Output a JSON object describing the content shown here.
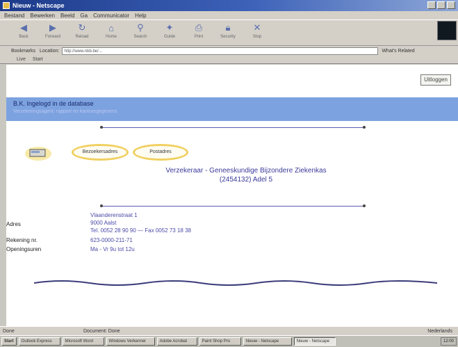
{
  "window": {
    "title": "Nieuw - Netscape"
  },
  "menu": [
    "Bestand",
    "Bewerken",
    "Beeld",
    "Ga",
    "Communicator",
    "Help"
  ],
  "toolbar": [
    {
      "label": "Back",
      "icon": "back-arrow-icon"
    },
    {
      "label": "Forward",
      "icon": "forward-arrow-icon"
    },
    {
      "label": "Reload",
      "icon": "reload-icon"
    },
    {
      "label": "Home",
      "icon": "home-icon"
    },
    {
      "label": "Search",
      "icon": "search-icon"
    },
    {
      "label": "Guide",
      "icon": "guide-icon"
    },
    {
      "label": "Print",
      "icon": "print-icon"
    },
    {
      "label": "Security",
      "icon": "security-icon"
    },
    {
      "label": "Stop",
      "icon": "stop-icon"
    }
  ],
  "address": {
    "bookmarks_label": "Bookmarks",
    "location_label": "Location:",
    "url": "http://www.nbb.be/...",
    "go_label": "What's Related"
  },
  "links": [
    "Live",
    "Start"
  ],
  "page": {
    "top_button": "Uitloggen",
    "header_title": "B.K. Ingelogd in de database",
    "header_subtitle": "Verzekeringsagent: rapport en kantoorgegevens",
    "btn_left": "Bezoekersadres",
    "btn_right": "Postadres",
    "center_title_1": "Verzekeraar - Geneeskundige Bijzondere Ziekenkas",
    "center_title_2": "(2454132) Adel 5",
    "info": {
      "address_label": "Adres",
      "address_lines": [
        "Vlaanderenstraat 1",
        "9000 Aalst",
        "Tel. 0052 28 90 90 — Fax 0052 73 18 38"
      ],
      "account_label": "Rekening nr.",
      "account_value": "623-0000-211-71",
      "hours_label": "Openingsuren",
      "hours_value": "Ma - Vr 9u tot 12u"
    }
  },
  "status": {
    "left": "Done",
    "mid": "Document: Done",
    "right": "Nederlands"
  },
  "taskbar": {
    "items": [
      "Start",
      "Outlook Express",
      "Microsoft Word",
      "Windows Verkenner",
      "Adobe Acrobat",
      "Nieuw - Netscape",
      "Paint Shop Pro"
    ],
    "clock": "12:00"
  },
  "colors": {
    "title_blue": "#1d3a8a",
    "header_band": "#7da2e0",
    "link_blue": "#4a4aa8",
    "highlight_yellow": "#f0d060"
  }
}
